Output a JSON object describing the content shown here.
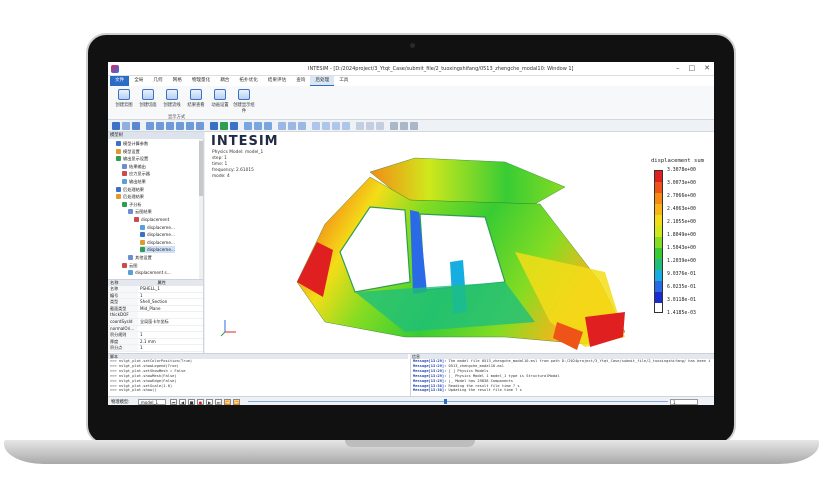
{
  "window": {
    "title": "INTESIM - [D:/2024project/3_Ytqt_Case/submit_file/2_tuoxingshifang/0513_zhengche_modal10: Window 1]",
    "controls": [
      "–",
      "□",
      "✕"
    ]
  },
  "menu": [
    "文件",
    "全局",
    "几何",
    "网格",
    "物理量化",
    "耦合",
    "拓扑优化",
    "结果评估",
    "查询",
    "后处理",
    "工具"
  ],
  "ribbon": {
    "buttons": [
      "创建云图",
      "创建切面",
      "创建流线",
      "结果查看",
      "动画设置",
      "创建显示组件"
    ],
    "group_label": "显示方式"
  },
  "left_panel": {
    "title": "模型树",
    "tree": [
      {
        "label": "模型计算参数",
        "indent": 1
      },
      {
        "label": "模型设置",
        "indent": 1
      },
      {
        "label": "输出显示设置",
        "indent": 1
      },
      {
        "label": "结果输出",
        "indent": 2
      },
      {
        "label": "应力显示器",
        "indent": 2
      },
      {
        "label": "输出结果",
        "indent": 2
      },
      {
        "label": "后处理结果",
        "indent": 1
      },
      {
        "label": "后处理结果",
        "indent": 1
      },
      {
        "label": "子分析",
        "indent": 2
      },
      {
        "label": "云图结果",
        "indent": 3
      },
      {
        "label": "displacement",
        "indent": 4
      },
      {
        "label": "displaceme...",
        "indent": 5
      },
      {
        "label": "displaceme...",
        "indent": 5
      },
      {
        "label": "displaceme...",
        "indent": 5
      },
      {
        "label": "displaceme...",
        "indent": 5
      },
      {
        "label": "其他设置",
        "indent": 3
      },
      {
        "label": "云图",
        "indent": 2
      },
      {
        "label": "displacement s...",
        "indent": 3
      }
    ],
    "selected_index": 14
  },
  "properties": {
    "headers": [
      "名称",
      "属性"
    ],
    "rows": [
      [
        "名称",
        "PSHELL_1"
      ],
      [
        "编号",
        "1"
      ],
      [
        "类型",
        "Shell_Section"
      ],
      [
        "截面类型",
        "Mid_Plane"
      ],
      [
        "thickDOF",
        ""
      ],
      [
        "coordSysId",
        "全局笛卡尔坐标"
      ],
      [
        "normalOri...",
        ""
      ],
      [
        "积分规则",
        "1"
      ],
      [
        "厚度",
        "2.1 mm"
      ],
      [
        "积分点",
        "1"
      ]
    ]
  },
  "viewport": {
    "brand": "INTESIM",
    "info": [
      "Physics Model: model_1",
      "step: 1",
      "time: 1",
      "frequency: 2.61015",
      "mode: 4"
    ]
  },
  "chart_data": {
    "type": "heatmap",
    "title": "displacement sum",
    "legend_values": [
      "3.3078e+00",
      "3.0073e+00",
      "2.7066e+00",
      "2.4063e+00",
      "2.1055e+00",
      "1.8049e+00",
      "1.5043e+00",
      "1.2039e+00",
      "9.0376e-01",
      "6.0235e-01",
      "3.0118e-01",
      "1.4185e-03"
    ],
    "colors": [
      "#e02020",
      "#ee5418",
      "#f58a16",
      "#f9b41a",
      "#f3dd18",
      "#cfe81c",
      "#86dc22",
      "#38cc34",
      "#1fbf7a",
      "#16aee0",
      "#2a6ae6",
      "#1a2cd0"
    ]
  },
  "console": {
    "title": "脚本",
    "lines": [
      ">>> nvlgt_plot.setColorPosition(True)",
      ">>> nvlgt_plot.showLegend(True)",
      ">>> nvlgt_plot.setShowMesh = False",
      ">>> nvlgt_plot.showMesh(False)",
      ">>> nvlgt_plot.showEdge(False)",
      ">>> nvlgt_plot.setScale(1.0)",
      ">>> nvlgt_plot.show()"
    ]
  },
  "messages": {
    "title": "信息",
    "lines": [
      {
        "tag": "Message[13:29]:",
        "text": " The model file 0513_zhengche_modal10.msl from path D:/2024project/3_Ytqt_Case/submit_file/2_tuoxingshifang/ has been imported"
      },
      {
        "tag": "Message[13:29]:",
        "text": " 0513_zhengche_modal10.msl"
      },
      {
        "tag": "Message[13:29]:",
        "text": " [ ] Physics Models"
      },
      {
        "tag": "Message[13:29]:",
        "text": "   |_ Physics Model 1 model_1 type is StructuralModal"
      },
      {
        "tag": "Message[13:29]:",
        "text": "   |_ Model has 29838 Components"
      },
      {
        "tag": "Message[13:30]:",
        "text": " Reading the result file time ? s"
      },
      {
        "tag": "Message[13:30]:",
        "text": " Updating the result file time ? s"
      }
    ]
  },
  "statusbar": {
    "label": "物理模型:",
    "model_select": "model_1",
    "playback": [
      "⏮",
      "◀",
      "■",
      "●",
      "▶",
      "⏭",
      "⏪",
      "⏩"
    ],
    "frame_value": "1"
  }
}
